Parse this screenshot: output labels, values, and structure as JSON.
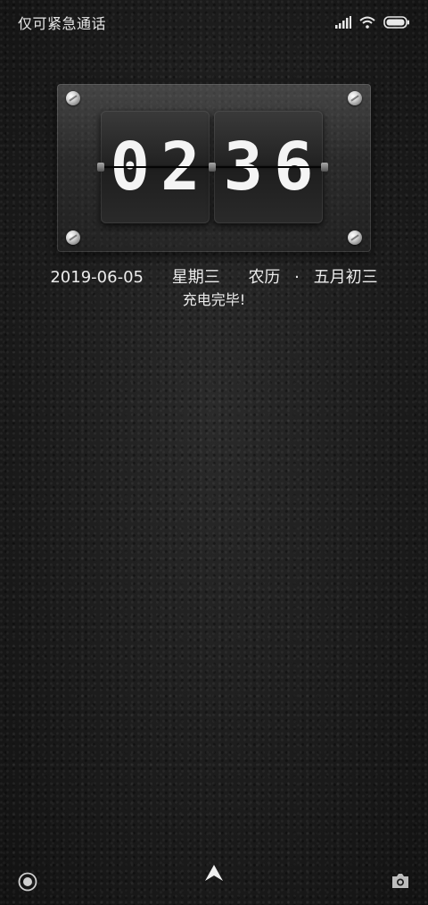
{
  "status_bar": {
    "carrier_text": "仅可紧急通话",
    "icons": [
      "signal-icon",
      "wifi-icon",
      "battery-icon"
    ]
  },
  "clock": {
    "hours": "02",
    "minutes": "36"
  },
  "date_info": {
    "date": "2019-06-05",
    "weekday": "星期三",
    "lunar_label": "农历",
    "separator": "·",
    "lunar_date": "五月初三"
  },
  "charging_text": "充电完毕!",
  "bottom_bar": {
    "left_icon": "voice-assistant-icon",
    "center_icon": "unlock-arrow-icon",
    "right_icon": "camera-icon"
  },
  "colors": {
    "text": "#ececec",
    "background": "#1a1a1a"
  }
}
